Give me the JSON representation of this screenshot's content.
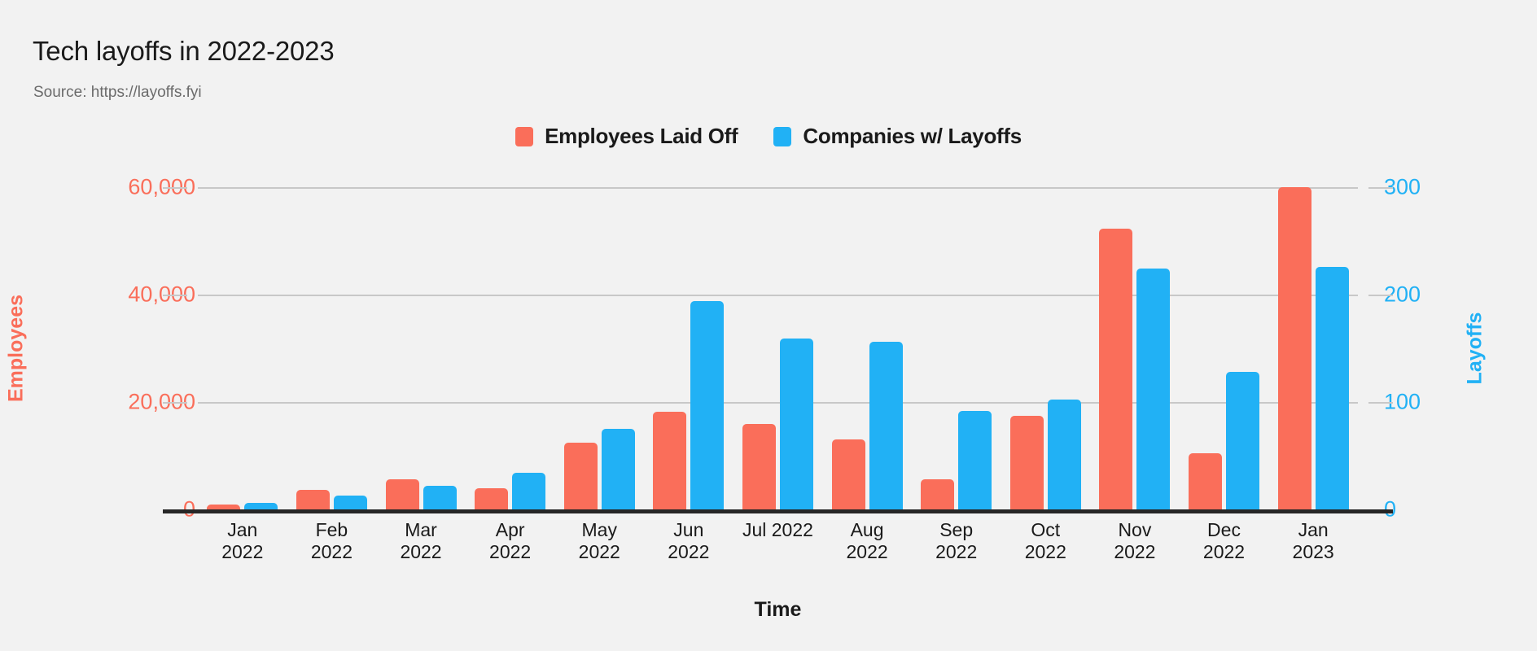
{
  "header": {
    "title": "Tech layoffs in 2022-2023",
    "source": "Source: https://layoffs.fyi"
  },
  "legend": {
    "position": "top-center",
    "items": [
      {
        "label": "Employees Laid Off",
        "color": "#fa6e5a",
        "swatch_name": "legend-swatch-employees"
      },
      {
        "label": "Companies w/ Layoffs",
        "color": "#21b1f5",
        "swatch_name": "legend-swatch-companies"
      }
    ]
  },
  "axes": {
    "x_title": "Time",
    "y_left_title": "Employees",
    "y_right_title": "Layoffs",
    "y_left_ticks": [
      "0",
      "20,000",
      "40,000",
      "60,000"
    ],
    "y_right_ticks": [
      "0",
      "100",
      "200",
      "300"
    ],
    "x_ticks": [
      "Jan\n2022",
      "Feb\n2022",
      "Mar\n2022",
      "Apr\n2022",
      "May\n2022",
      "Jun\n2022",
      "Jul 2022",
      "Aug\n2022",
      "Sep\n2022",
      "Oct\n2022",
      "Nov\n2022",
      "Dec\n2022",
      "Jan\n2023"
    ]
  },
  "chart_data": {
    "type": "bar",
    "title": "Tech layoffs in 2022-2023",
    "subtitle": "Source: https://layoffs.fyi",
    "xlabel": "Time",
    "ylabel": "Employees",
    "y2label": "Layoffs",
    "ylim": [
      0,
      60000
    ],
    "y2lim": [
      0,
      300
    ],
    "yticks": [
      0,
      20000,
      40000,
      60000
    ],
    "y2ticks": [
      0,
      100,
      200,
      300
    ],
    "grid": true,
    "legend_position": "top-center",
    "categories": [
      "Jan 2022",
      "Feb 2022",
      "Mar 2022",
      "Apr 2022",
      "May 2022",
      "Jun 2022",
      "Jul 2022",
      "Aug 2022",
      "Sep 2022",
      "Oct 2022",
      "Nov 2022",
      "Dec 2022",
      "Jan 2023"
    ],
    "series": [
      {
        "name": "Employees Laid Off",
        "color": "#fa6e5a",
        "axis": "left",
        "values": [
          900,
          3700,
          5600,
          4000,
          12400,
          18200,
          15900,
          13100,
          5600,
          17400,
          52300,
          10500,
          60000
        ]
      },
      {
        "name": "Companies w/ Layoffs",
        "color": "#21b1f5",
        "axis": "right",
        "values": [
          6,
          13,
          22,
          34,
          75,
          194,
          159,
          156,
          92,
          102,
          224,
          128,
          226
        ]
      }
    ]
  },
  "colors": {
    "background": "#f2f2f2",
    "employees": "#fa6e5a",
    "companies": "#21b1f5",
    "gridline": "#c8c8c8",
    "baseline": "#262626",
    "title_text": "#1a1a1a",
    "subtitle_text": "#6b6b6b"
  }
}
